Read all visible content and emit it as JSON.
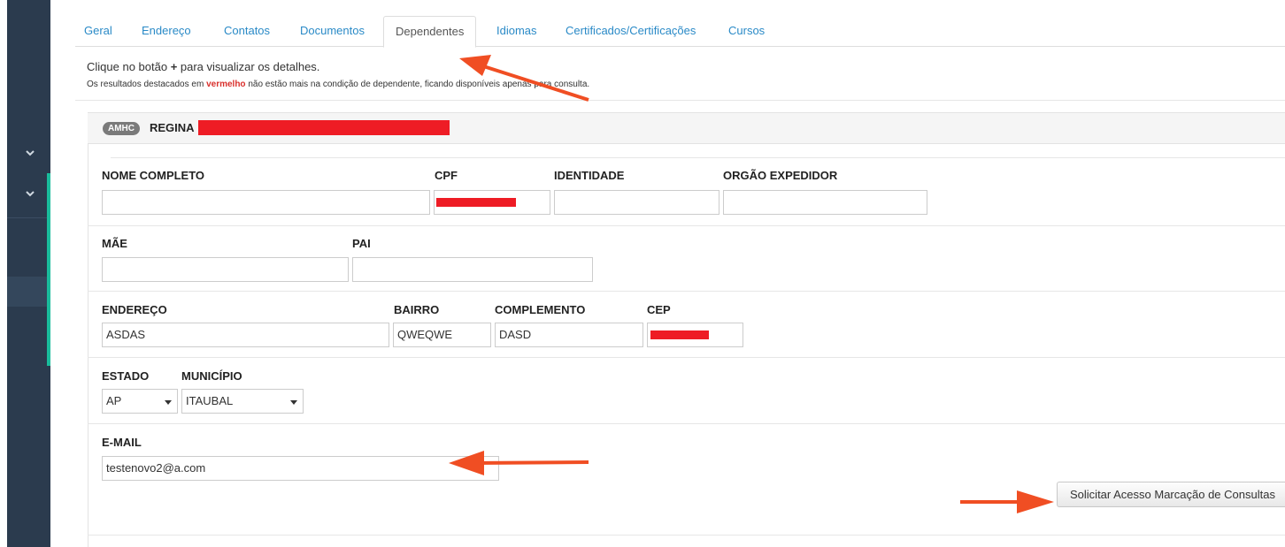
{
  "tabs": [
    {
      "label": "Geral"
    },
    {
      "label": "Endereço"
    },
    {
      "label": "Contatos"
    },
    {
      "label": "Documentos"
    },
    {
      "label": "Dependentes"
    },
    {
      "label": "Idiomas"
    },
    {
      "label": "Certificados/Certificações"
    },
    {
      "label": "Cursos"
    }
  ],
  "active_tab": "Dependentes",
  "instructions": {
    "line1_prefix": "Clique no botão ",
    "line1_plus": "+",
    "line1_suffix": " para visualizar os detalhes.",
    "line2_prefix": "Os resultados destacados em ",
    "line2_red": "vermelho",
    "line2_suffix": " não estão mais na condição de dependente, ficando disponíveis apenas para consulta."
  },
  "dependent": {
    "badge": "AMHC",
    "name": "REGINA"
  },
  "form": {
    "nome_completo": {
      "label": "NOME COMPLETO",
      "value": ""
    },
    "cpf": {
      "label": "CPF"
    },
    "identidade": {
      "label": "IDENTIDADE",
      "value": ""
    },
    "orgao_expedidor": {
      "label": "ORGÃO EXPEDIDOR",
      "value": ""
    },
    "mae": {
      "label": "MÃE",
      "value": ""
    },
    "pai": {
      "label": "PAI",
      "value": ""
    },
    "endereco": {
      "label": "ENDEREÇO",
      "value": "ASDAS"
    },
    "bairro": {
      "label": "BAIRRO",
      "value": "QWEQWE"
    },
    "complemento": {
      "label": "COMPLEMENTO",
      "value": "DASD"
    },
    "cep": {
      "label": "CEP"
    },
    "estado": {
      "label": "ESTADO",
      "value": "AP"
    },
    "municipio": {
      "label": "MUNICÍPIO",
      "value": "ITAUBAL"
    },
    "email": {
      "label": "E-MAIL",
      "value": "testenovo2@a.com"
    }
  },
  "actions": {
    "solicitar_label": "Solicitar Acesso Marcação de Consultas"
  },
  "colors": {
    "link": "#2a8ac7",
    "redaction": "#ee1c25",
    "annotation_arrow": "#f04e23",
    "sidebar": "#2b3b4e",
    "sidebar_accent": "#1abc9c"
  },
  "icons": {
    "sidebar": [
      "chevron-down-icon",
      "chevron-down-icon"
    ],
    "select": "caret-down-icon"
  }
}
